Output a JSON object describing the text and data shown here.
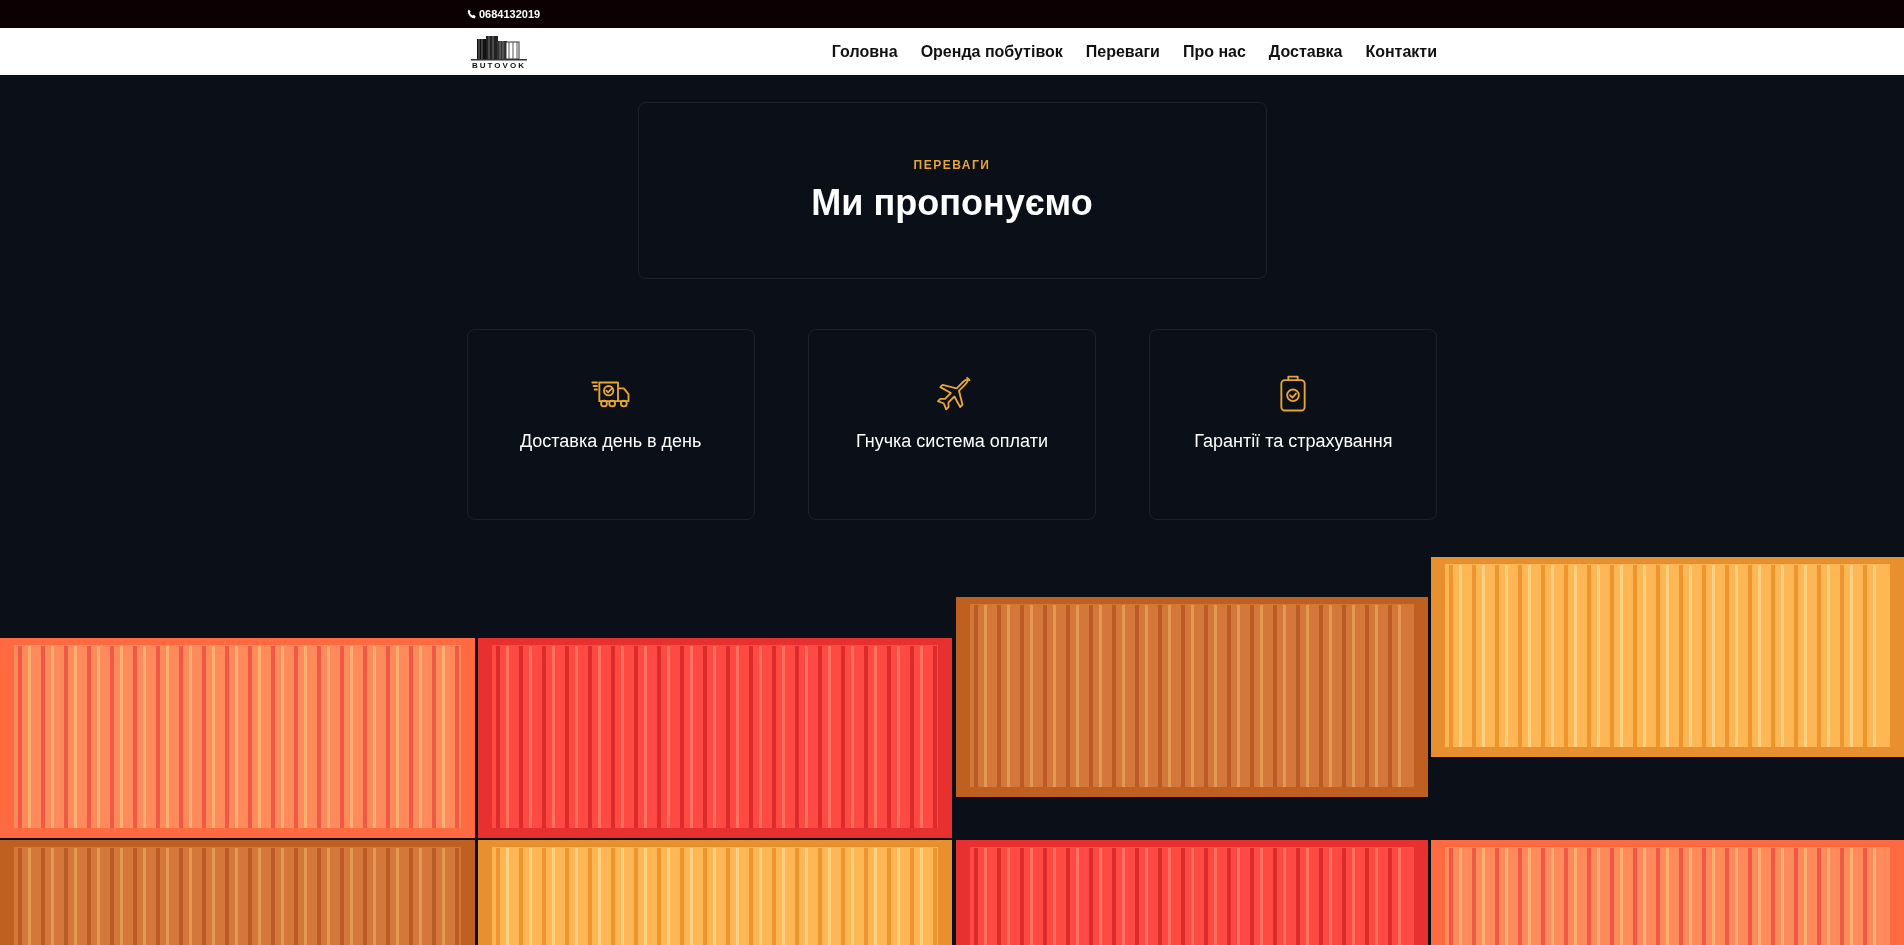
{
  "top_bar": {
    "phone": "0684132019"
  },
  "header": {
    "logo_text": "BUTOVOK",
    "nav": [
      {
        "label": "Головна"
      },
      {
        "label": "Оренда побутівок"
      },
      {
        "label": "Переваги"
      },
      {
        "label": "Про нас"
      },
      {
        "label": "Доставка"
      },
      {
        "label": "Контакти"
      }
    ]
  },
  "intro": {
    "eyebrow": "ПЕРЕВАГИ",
    "heading": "Ми пропонуємо"
  },
  "features": [
    {
      "kind": "truck",
      "title": "Доставка день в день"
    },
    {
      "kind": "plane",
      "title": "Гнучка система оплати"
    },
    {
      "kind": "clipboard",
      "title": "Гарантії та страхування"
    }
  ]
}
